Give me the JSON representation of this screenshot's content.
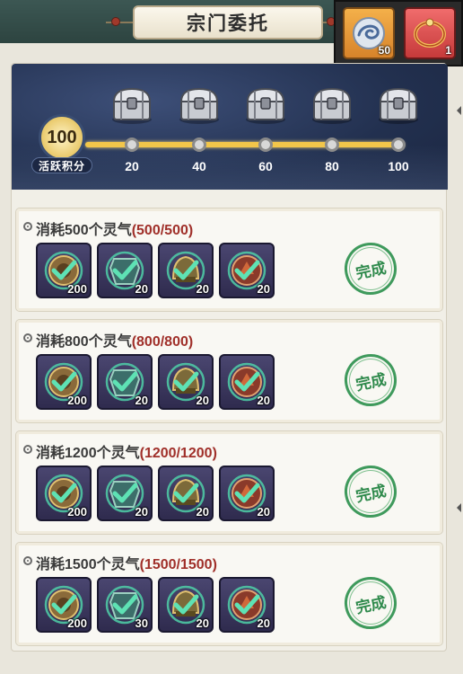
{
  "header": {
    "title": "宗门委托"
  },
  "currency": [
    {
      "icon": "spirit-swirl-icon",
      "count": "50"
    },
    {
      "icon": "crimson-bracelet-icon",
      "count": "1"
    }
  ],
  "activity": {
    "score": "100",
    "label": "活跃积分",
    "milestones": [
      "20",
      "40",
      "60",
      "80",
      "100"
    ],
    "progress_fraction": 1.0
  },
  "tasks": [
    {
      "title": "消耗500个灵气",
      "progress": "(500/500)",
      "rewards": [
        {
          "icon": "bronze-emblem-icon",
          "qty": "200"
        },
        {
          "icon": "jade-armor-icon",
          "qty": "20"
        },
        {
          "icon": "bronze-helmet-icon",
          "qty": "20"
        },
        {
          "icon": "red-crest-icon",
          "qty": "20"
        }
      ],
      "status": "完成"
    },
    {
      "title": "消耗800个灵气",
      "progress": "(800/800)",
      "rewards": [
        {
          "icon": "bronze-emblem-icon",
          "qty": "200"
        },
        {
          "icon": "jade-armor-icon",
          "qty": "20"
        },
        {
          "icon": "bronze-helmet-icon",
          "qty": "20"
        },
        {
          "icon": "red-crest-icon",
          "qty": "20"
        }
      ],
      "status": "完成"
    },
    {
      "title": "消耗1200个灵气",
      "progress": "(1200/1200)",
      "rewards": [
        {
          "icon": "bronze-emblem-icon",
          "qty": "200"
        },
        {
          "icon": "jade-armor-icon",
          "qty": "20"
        },
        {
          "icon": "bronze-helmet-icon",
          "qty": "20"
        },
        {
          "icon": "red-crest-icon",
          "qty": "20"
        }
      ],
      "status": "完成"
    },
    {
      "title": "消耗1500个灵气",
      "progress": "(1500/1500)",
      "rewards": [
        {
          "icon": "bronze-emblem-icon",
          "qty": "200"
        },
        {
          "icon": "jade-armor-icon",
          "qty": "30"
        },
        {
          "icon": "bronze-helmet-icon",
          "qty": "20"
        },
        {
          "icon": "red-crest-icon",
          "qty": "20"
        }
      ],
      "status": "完成"
    }
  ],
  "colors": {
    "progress_red": "#a0302a",
    "complete_green": "#2f8a4c",
    "track_gold": "#f2c64a"
  }
}
